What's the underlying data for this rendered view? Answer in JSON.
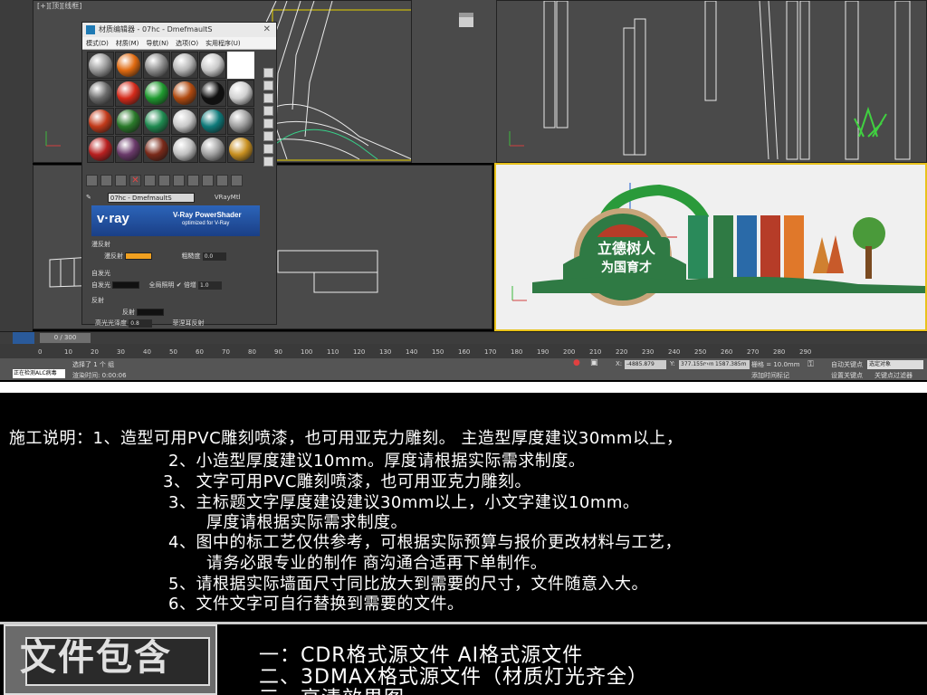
{
  "material_editor": {
    "title": "材质编辑器 - 07hc - DmefmaultS",
    "menu": [
      "模式(D)",
      "材质(M)",
      "导航(N)",
      "选项(O)",
      "实用程序(U)"
    ],
    "material_name": "07hc - DmefmaultS",
    "material_type": "VRayMtl",
    "vray_logo": "v·ray",
    "vray_title": "V-Ray PowerShader",
    "vray_subtitle": "optimized for V-Ray",
    "diffuse_group": "漫反射",
    "diffuse_label": "漫反射",
    "roughness_label": "粗糙度",
    "roughness_value": "0.0",
    "self_illum_group": "自发光",
    "self_illum_label": "自发光",
    "gi_label": "全局照明",
    "multiplier_label": "倍增",
    "multiplier_value": "1.0",
    "reflect_group": "反射",
    "reflect_label": "反射",
    "gloss_label": "高光光泽度",
    "gloss_value": "0.8",
    "fresnel_label": "菲涅耳反射",
    "diffuse_color": "#f0a020",
    "samples": [
      "#9a9a9a",
      "#e06a10",
      "#8d8d8d",
      "#b5b5b5",
      "#c9c9c9",
      "#ffffff",
      "#6c6c6c",
      "#d42a1a",
      "#1f9a2f",
      "#b04a10",
      "#101010",
      "#d0d0d0",
      "#c23a1a",
      "#2a7a2a",
      "#1f8a50",
      "#c8c8c8",
      "#0e7a7a",
      "#9e9e9e",
      "#b82020",
      "#6a3a6a",
      "#7a2a1a",
      "#c0c0c0",
      "#a0a0a0",
      "#c89020"
    ]
  },
  "viewport": {
    "sign_main": "立德树人",
    "sign_sub": "为国育才"
  },
  "timeline": {
    "frame": "0 / 300",
    "ticks": [
      "0",
      "10",
      "20",
      "30",
      "40",
      "50",
      "60",
      "70",
      "80",
      "90",
      "100",
      "110",
      "120",
      "130",
      "140",
      "150",
      "160",
      "170",
      "180",
      "190",
      "200",
      "210",
      "220",
      "230",
      "240",
      "250",
      "260",
      "270",
      "280",
      "290"
    ]
  },
  "status": {
    "left_text": "正在检测ALC病毒",
    "selection": "选择了 1 个 组",
    "time": "渲染时间: 0:00:06",
    "x_label": "X:",
    "x": "-4885.879",
    "y_label": "Y:",
    "y": "377.155mm",
    "z_label": "Z:",
    "z": "1587.385m",
    "grid": "栅格 = 10.0mm",
    "auto_key": "自动关键点",
    "set_key": "设置关键点",
    "selected_object": "选定对象",
    "add_time_tag": "添加时间标记",
    "key_filter": "关键点过滤器"
  },
  "notes": [
    "施工说明：1、造型可用PVC雕刻喷漆，也可用亚克力雕刻。  主造型厚度建议30mm以上，",
    "2、小造型厚度建议10mm。厚度请根据实际需求制度。",
    "3、 文字可用PVC雕刻喷漆，也可用亚克力雕刻。",
    "3、主标题文字厚度建设建议30mm以上，小文字建议10mm。",
    "厚度请根据实际需求制度。",
    "4、图中的标工艺仅供参考，可根据实际预算与报价更改材料与工艺，",
    "请务必跟专业的制作 商沟通合适再下单制作。",
    "5、请根据实际墙面尺寸同比放大到需要的尺寸，文件随意入大。",
    "6、文件文字可自行替换到需要的文件。"
  ],
  "files": {
    "title": "文件包含",
    "items": [
      "一：CDR格式源文件  AI格式源文件",
      "二、3DMAX格式源文件（材质灯光齐全）",
      "三、高清效果图"
    ]
  }
}
